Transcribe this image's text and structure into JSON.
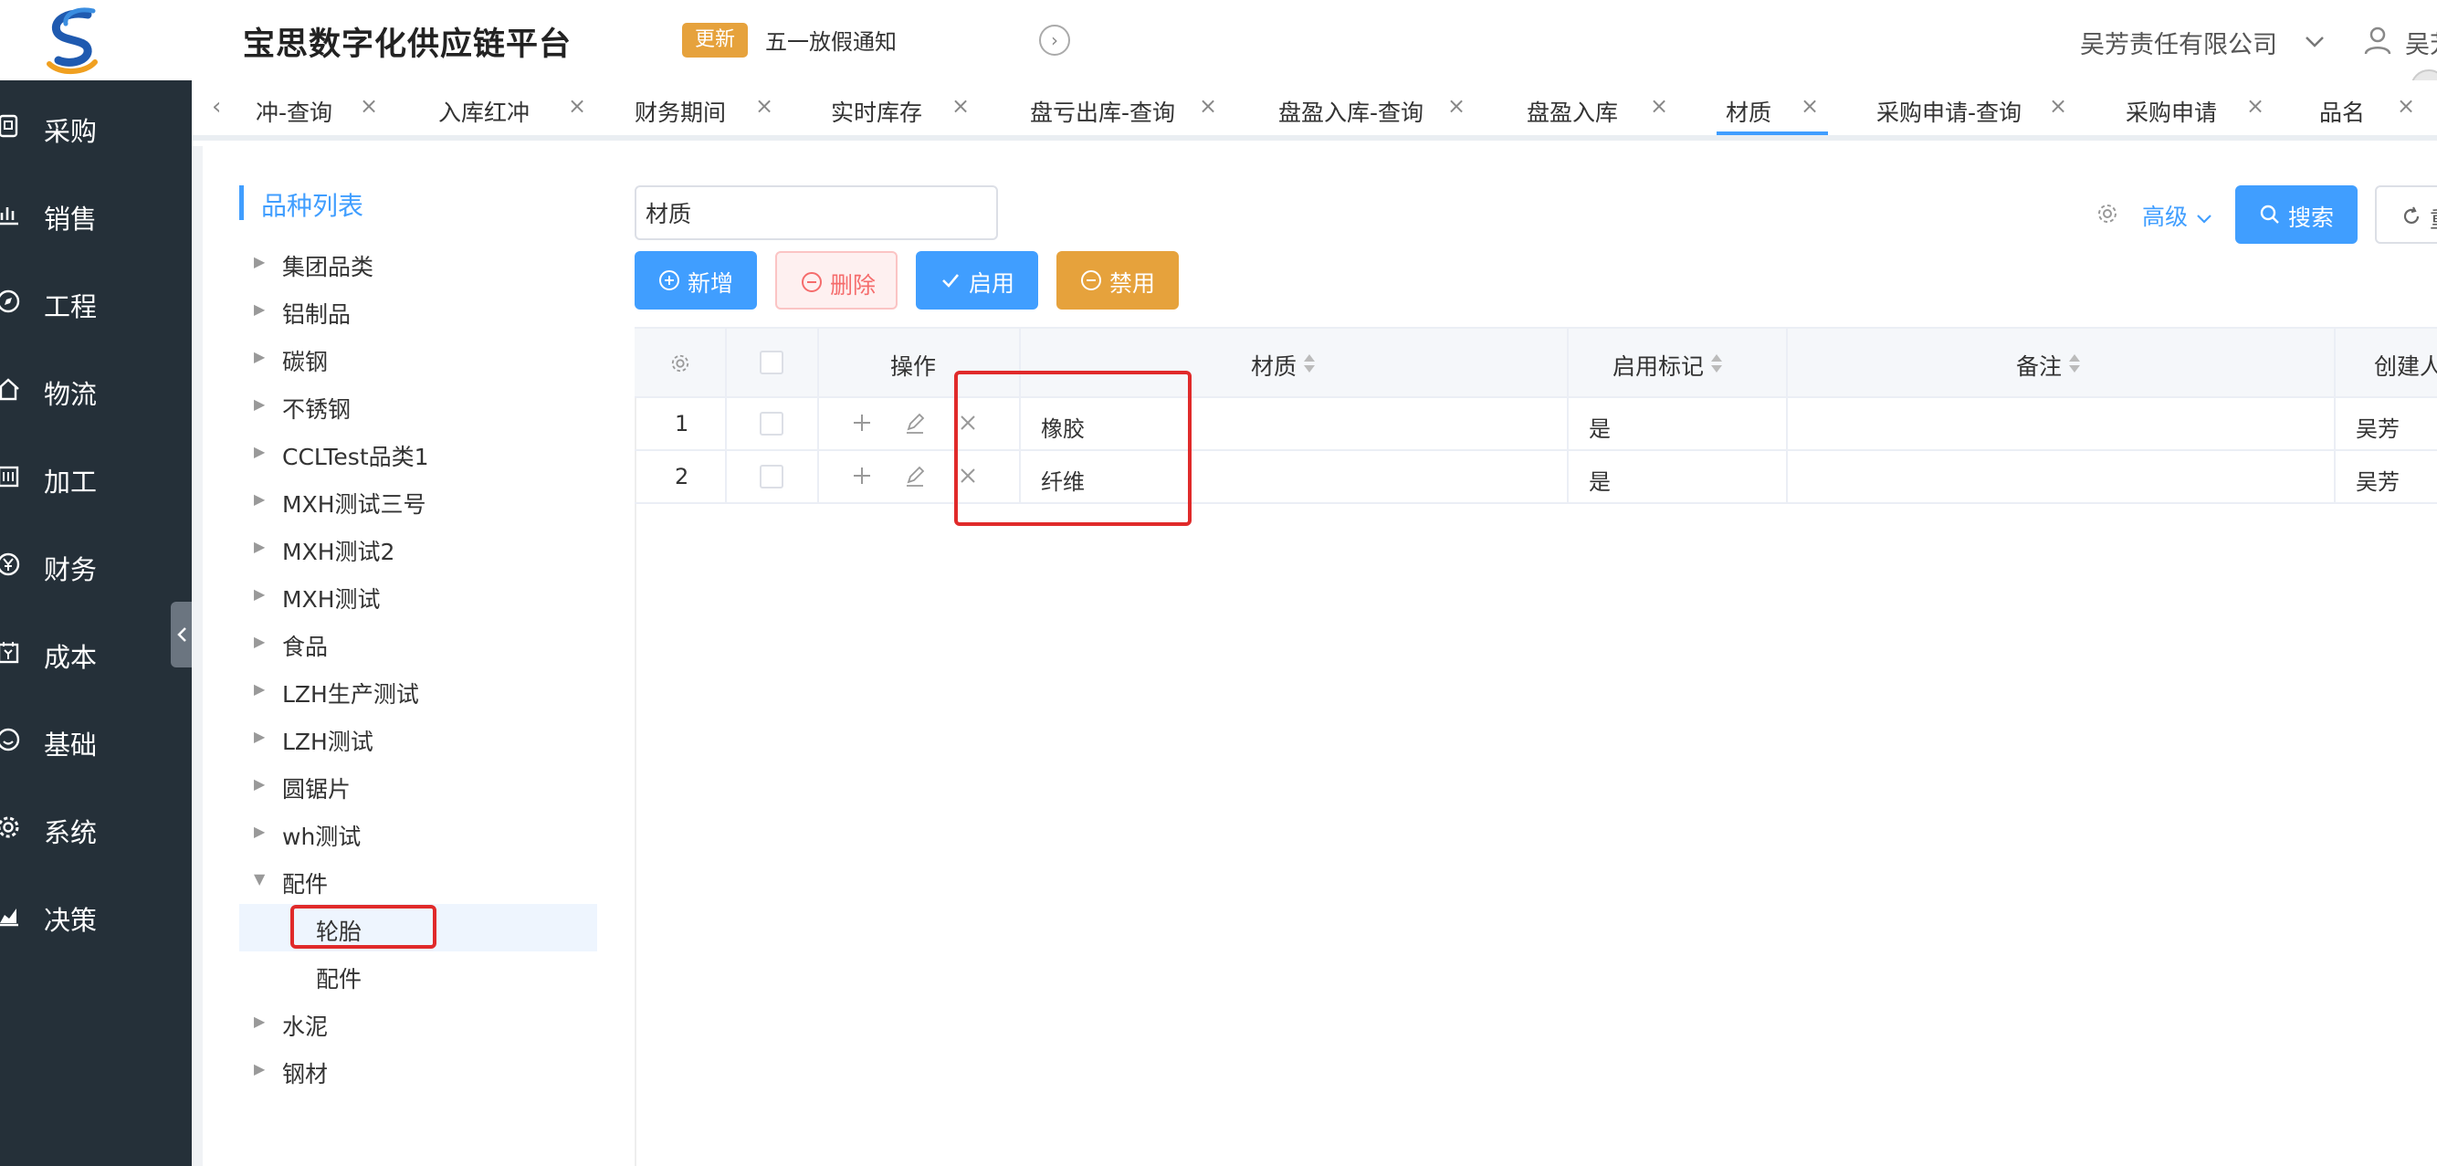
{
  "header": {
    "app_title": "宝思数字化供应链平台",
    "update_badge": "更新",
    "notice": "五一放假通知",
    "company": "吴芳责任有限公司",
    "user_name": "吴芳"
  },
  "sidebar": {
    "items": [
      {
        "label": "采购",
        "icon": "cart-icon"
      },
      {
        "label": "销售",
        "icon": "bar-chart-icon"
      },
      {
        "label": "工程",
        "icon": "compass-icon"
      },
      {
        "label": "物流",
        "icon": "home-icon"
      },
      {
        "label": "加工",
        "icon": "factory-icon"
      },
      {
        "label": "财务",
        "icon": "yen-icon"
      },
      {
        "label": "成本",
        "icon": "calendar-yen-icon"
      },
      {
        "label": "基础",
        "icon": "smile-icon"
      },
      {
        "label": "系统",
        "icon": "gear-icon"
      },
      {
        "label": "决策",
        "icon": "area-chart-icon"
      }
    ]
  },
  "tabs": [
    {
      "label": "冲-查询"
    },
    {
      "label": "入库红冲"
    },
    {
      "label": "财务期间"
    },
    {
      "label": "实时库存"
    },
    {
      "label": "盘亏出库-查询"
    },
    {
      "label": "盘盈入库-查询"
    },
    {
      "label": "盘盈入库"
    },
    {
      "label": "材质",
      "active": true
    },
    {
      "label": "采购申请-查询"
    },
    {
      "label": "采购申请"
    },
    {
      "label": "品名"
    }
  ],
  "tree": {
    "title": "品种列表",
    "nodes": [
      {
        "label": "集团品类"
      },
      {
        "label": "铝制品"
      },
      {
        "label": "碳钢"
      },
      {
        "label": "不锈钢"
      },
      {
        "label": "CCLTest品类1"
      },
      {
        "label": "MXH测试三号"
      },
      {
        "label": "MXH测试2"
      },
      {
        "label": "MXH测试"
      },
      {
        "label": "食品"
      },
      {
        "label": "LZH生产测试"
      },
      {
        "label": "LZH测试"
      },
      {
        "label": "圆锯片"
      },
      {
        "label": "wh测试"
      },
      {
        "label": "配件",
        "expanded": true
      },
      {
        "label": "轮胎",
        "child": true,
        "selected": true
      },
      {
        "label": "配件",
        "child": true
      },
      {
        "label": "水泥"
      },
      {
        "label": "钢材"
      }
    ]
  },
  "search": {
    "value": "材质",
    "advanced_label": "高级",
    "search_label": "搜索",
    "reset_label": "重置"
  },
  "toolbar": {
    "add_label": "新增",
    "delete_label": "删除",
    "enable_label": "启用",
    "disable_label": "禁用"
  },
  "table": {
    "columns": {
      "ops": "操作",
      "material": "材质",
      "enabled": "启用标记",
      "remark": "备注",
      "creator": "创建人"
    },
    "rows": [
      {
        "index": "1",
        "material": "橡胶",
        "enabled": "是",
        "remark": "",
        "creator": "吴芳"
      },
      {
        "index": "2",
        "material": "纤维",
        "enabled": "是",
        "remark": "",
        "creator": "吴芳"
      }
    ]
  },
  "colors": {
    "primary": "#409eff",
    "warning": "#e6a23c",
    "danger": "#f56c6c",
    "sidebar_bg": "#253039",
    "highlight": "#e02a2a"
  }
}
